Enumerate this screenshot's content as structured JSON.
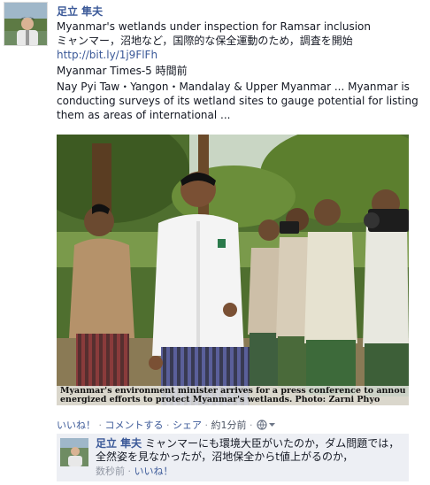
{
  "post": {
    "author": "足立 隼夫",
    "headline_en": "Myanmar's wetlands under inspection for Ramsar inclusion",
    "headline_ja": "ミャンマー，沼地など，国際的な保全運動のため，調査を開始",
    "link": "http://bit.ly/1j9FlFh",
    "source": "Myanmar Times-5 時間前",
    "snippet": "Nay Pyi Taw・Yangon・Mandalay & Upper Myanmar ... Myanmar is conducting surveys of its wetland sites to gauge potential for listing them as areas of international ...",
    "photo_caption_line1": "Myanmar's environment minister arrives for a press conference to announce",
    "photo_caption_line2": "energized efforts to protect Myanmar's wetlands. Photo: Zarni Phyo"
  },
  "actions": {
    "like": "いいね！",
    "sep": " · ",
    "comment": "コメントする",
    "share": "シェア",
    "time": "約1分前",
    "privacy_icon": "globe-icon",
    "dropdown_icon": "chevron-down-icon"
  },
  "comment": {
    "author": "足立 隼夫",
    "text": "ミャンマーにも環境大臣がいたのか，ダム問題では，全然姿を見なかったが，沼地保全からt値上がるのか，",
    "time": "数秒前",
    "like": "いいね！"
  },
  "colors": {
    "link": "#3b5998",
    "comment_bg": "#edeff4",
    "muted": "#9197a3"
  }
}
